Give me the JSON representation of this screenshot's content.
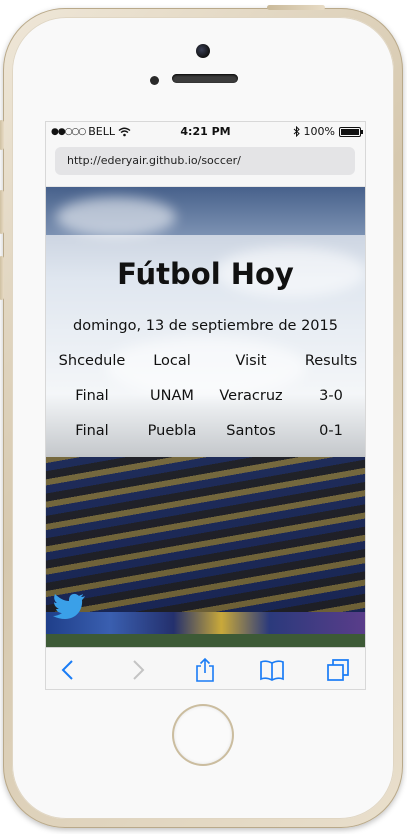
{
  "status_bar": {
    "signal": "●●○○○",
    "carrier": "BELL",
    "time": "4:21 PM",
    "battery_percent": "100%"
  },
  "url_bar": {
    "url": "http://ederyair.github.io/soccer/"
  },
  "page": {
    "title": "Fútbol Hoy",
    "date": "domingo, 13 de septiembre de 2015",
    "table": {
      "headers": [
        "Shcedule",
        "Local",
        "Visit",
        "Results"
      ],
      "rows": [
        [
          "Final",
          "UNAM",
          "Veracruz",
          "3-0"
        ],
        [
          "Final",
          "Puebla",
          "Santos",
          "0-1"
        ]
      ]
    }
  },
  "toolbar": {
    "icons": [
      "back-chevron-icon",
      "forward-chevron-icon",
      "share-icon",
      "bookmarks-icon",
      "tabs-icon"
    ],
    "accent_color": "#1a7cf5",
    "disabled_color": "#c4c4c4"
  }
}
